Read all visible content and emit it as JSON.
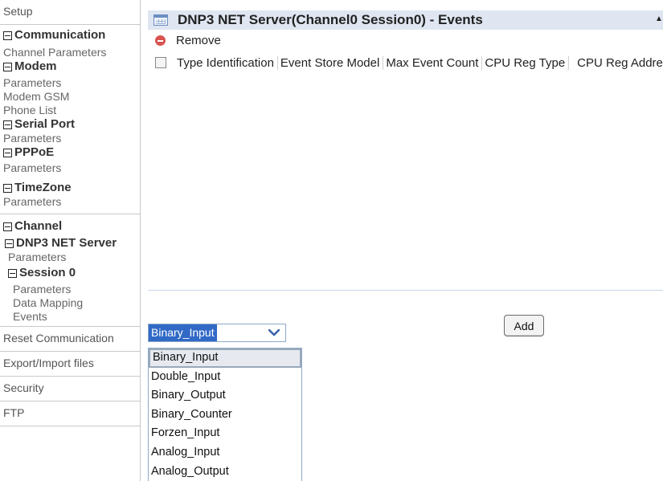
{
  "sidebar": {
    "setup": "Setup",
    "communication": {
      "title": "Communication",
      "channel_parameters": "Channel Parameters",
      "modem": {
        "title": "Modem",
        "items": [
          "Parameters",
          "Modem GSM",
          "Phone List"
        ]
      },
      "serial_port": {
        "title": "Serial Port",
        "items": [
          "Parameters"
        ]
      },
      "pppoe": {
        "title": "PPPoE",
        "items": [
          "Parameters"
        ]
      },
      "timezone": {
        "title": "TimeZone",
        "items": [
          "Parameters"
        ]
      }
    },
    "channel": {
      "title": "Channel",
      "server": {
        "title": "DNP3 NET Server",
        "items": [
          "Parameters"
        ]
      },
      "session": {
        "title": "Session 0",
        "items": [
          "Parameters",
          "Data Mapping",
          "Events"
        ]
      }
    },
    "reset_communication": "Reset Communication",
    "export_import": "Export/Import files",
    "security": "Security",
    "ftp": "FTP"
  },
  "main": {
    "title": "DNP3 NET Server(Channel0 Session0) - Events",
    "remove_label": "Remove",
    "columns": [
      "Type Identification",
      "Event Store Model",
      "Max Event Count",
      "CPU Reg Type",
      "CPU Reg Address"
    ],
    "rows": [],
    "add_label": "Add",
    "type_select": {
      "selected": "Binary_Input",
      "options": [
        "Binary_Input",
        "Double_Input",
        "Binary_Output",
        "Binary_Counter",
        "Forzen_Input",
        "Analog_Input",
        "Analog_Output"
      ]
    }
  },
  "colors": {
    "title_bar": "#dfe6f1",
    "select_highlight": "#3169c6",
    "remove_icon": "#d9534f"
  },
  "icons": {
    "grid": "grid-table-icon",
    "remove": "minus-circle-icon",
    "dropdown": "chevron-down-icon",
    "scroll": "triangle-up-icon",
    "collapse": "tree-collapse-icon"
  }
}
